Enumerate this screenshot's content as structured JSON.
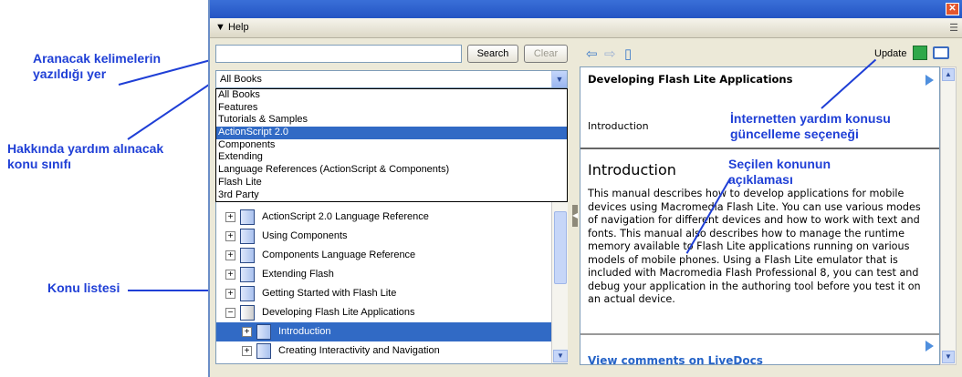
{
  "annotations": {
    "search_area": "Aranacak kelimelerin\nyazıldığı yer",
    "topic_class": "Hakkında yardım alınacak\nkonu sınıfı",
    "topic_list": "Konu listesi",
    "update_option": "İnternetten yardım konusu\ngüncelleme seçeneği",
    "topic_description": "Seçilen konunun\naçıklaması"
  },
  "panel": {
    "title": "▼ Help",
    "close_glyph": "✕",
    "menu_glyph": "☰"
  },
  "search": {
    "value": "",
    "search_label": "Search",
    "clear_label": "Clear"
  },
  "book_select": {
    "selected": "All Books",
    "options": [
      "All Books",
      "Features",
      "Tutorials & Samples",
      "ActionScript 2.0",
      "Components",
      "Extending",
      "Language References (ActionScript & Components)",
      "Flash Lite",
      "3rd Party"
    ],
    "highlighted_index": 3
  },
  "toc": {
    "items": [
      {
        "label": "ActionScript 2.0 Language Reference",
        "expander": "+",
        "indent": 0,
        "selected": false
      },
      {
        "label": "Using Components",
        "expander": "+",
        "indent": 0,
        "selected": false
      },
      {
        "label": "Components Language Reference",
        "expander": "+",
        "indent": 0,
        "selected": false
      },
      {
        "label": "Extending Flash",
        "expander": "+",
        "indent": 0,
        "selected": false
      },
      {
        "label": "Getting Started with Flash Lite",
        "expander": "+",
        "indent": 0,
        "selected": false
      },
      {
        "label": "Developing Flash Lite Applications",
        "expander": "−",
        "indent": 0,
        "selected": false
      },
      {
        "label": "Introduction",
        "expander": "+",
        "indent": 1,
        "selected": true
      },
      {
        "label": "Creating Interactivity and Navigation",
        "expander": "+",
        "indent": 1,
        "selected": false
      }
    ]
  },
  "toolbar": {
    "back_glyph": "⇦",
    "forward_glyph": "⇨",
    "book_glyph": "▯",
    "update_label": "Update"
  },
  "content": {
    "doc_title": "Developing Flash Lite Applications",
    "breadcrumb": "Introduction",
    "heading": "Introduction",
    "body": "This manual describes how to develop applications for mobile devices using Macromedia Flash Lite. You can use various modes of navigation for different devices and how to work with text and fonts. This manual also describes how to manage the runtime memory available to Flash Lite applications running on various models of mobile phones. Using a Flash Lite emulator that is included with Macromedia Flash Professional 8, you can test and debug your application in the authoring tool before you test it on an actual device.",
    "livedocs_link": "View comments on LiveDocs"
  },
  "colors": {
    "annotation": "#1f3fd6",
    "selection": "#316ac5",
    "title_bar": "#2455c3",
    "link": "#2563c7"
  }
}
